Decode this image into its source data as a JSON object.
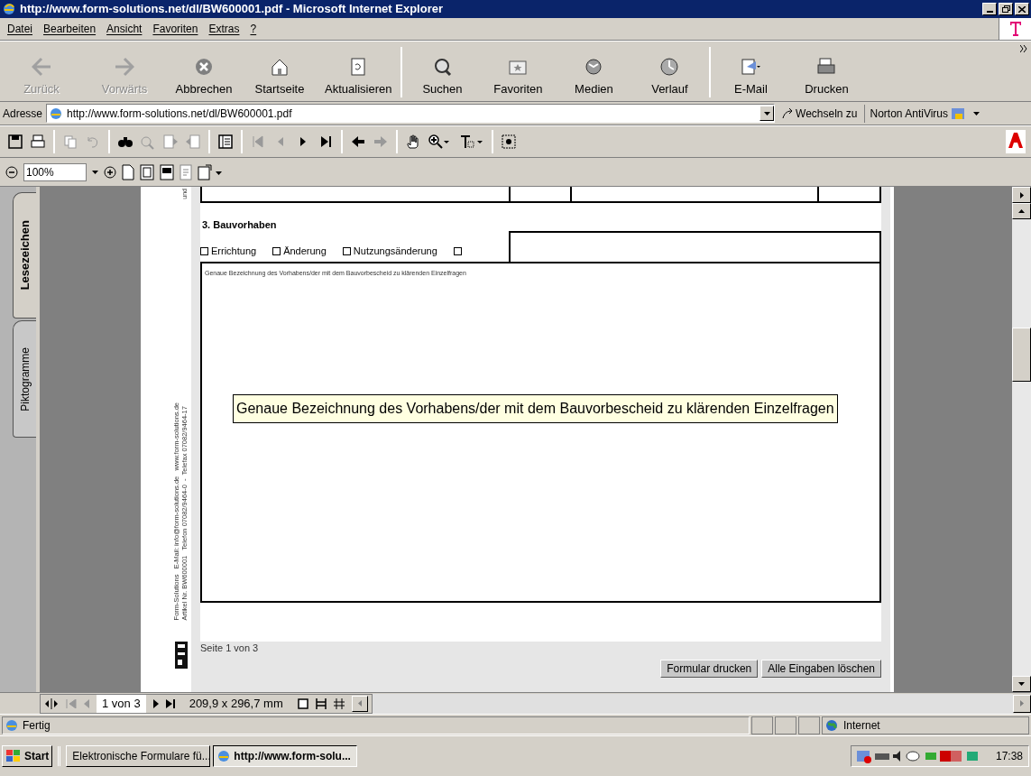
{
  "window": {
    "title": "http://www.form-solutions.net/dl/BW600001.pdf - Microsoft Internet Explorer"
  },
  "menu": [
    "Datei",
    "Bearbeiten",
    "Ansicht",
    "Favoriten",
    "Extras",
    "?"
  ],
  "toolbar": [
    {
      "kind": "back",
      "label": "Zurück",
      "disabled": true
    },
    {
      "kind": "forward",
      "label": "Vorwärts",
      "disabled": true
    },
    {
      "kind": "stop",
      "label": "Abbrechen",
      "disabled": false
    },
    {
      "kind": "home",
      "label": "Startseite",
      "disabled": false
    },
    {
      "kind": "refresh",
      "label": "Aktualisieren",
      "disabled": false
    },
    {
      "kind": "search",
      "label": "Suchen",
      "disabled": false
    },
    {
      "kind": "favorites",
      "label": "Favoriten",
      "disabled": false
    },
    {
      "kind": "media",
      "label": "Medien",
      "disabled": false
    },
    {
      "kind": "history",
      "label": "Verlauf",
      "disabled": false
    },
    {
      "kind": "mail",
      "label": "E-Mail",
      "disabled": false
    },
    {
      "kind": "print",
      "label": "Drucken",
      "disabled": false
    }
  ],
  "address_bar": {
    "label": "Adresse",
    "url": "http://www.form-solutions.net/dl/BW600001.pdf",
    "go_button": "Wechseln zu",
    "norton": "Norton AntiVirus"
  },
  "acrobat": {
    "zoom": "100%"
  },
  "side_tabs": [
    {
      "label": "Lesezeichen",
      "selected": true
    },
    {
      "label": "Piktogramme",
      "selected": false
    }
  ],
  "document": {
    "top_cut_text": "und",
    "margin_lines": [
      "Form-Solutions   E-Mail: info@form-solutions.de   www.form-solutions.de",
      "Artikel Nr. BW600001   Telefon 07082/9464-0  -  Telefax 07082/9464-17"
    ],
    "section_heading": "3. Bauvorhaben",
    "checkboxes": [
      {
        "label": "Errichtung",
        "checked": false
      },
      {
        "label": "Änderung",
        "checked": false
      },
      {
        "label": "Nutzungsänderung",
        "checked": false
      },
      {
        "checked": false
      }
    ],
    "field_label": "Genaue Bezeichnung des Vorhabens/der mit dem Bauvorbescheid zu klärenden Einzelfragen",
    "tooltip": "Genaue Bezeichnung des Vorhabens/der mit dem Bauvorbescheid zu klärenden Einzelfragen",
    "page_footer": "Seite 1 von 3",
    "buttons": [
      "Formular drucken",
      "Alle Eingaben löschen"
    ]
  },
  "acrobat_status": {
    "page": "1 von 3",
    "size": "209,9 x 296,7 mm"
  },
  "status_bar": {
    "text": "Fertig",
    "zone": "Internet"
  },
  "taskbar": {
    "start": "Start",
    "tasks": [
      {
        "label": "Elektronische Formulare fü...",
        "selected": false
      },
      {
        "label": "http://www.form-solu...",
        "selected": true
      }
    ],
    "clock": "17:38"
  }
}
